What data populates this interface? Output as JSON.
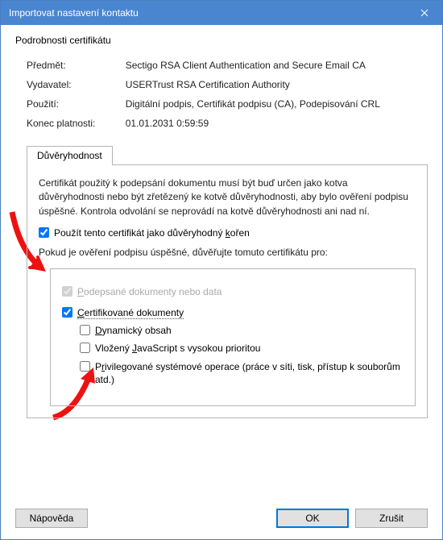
{
  "titlebar": {
    "title": "Importovat nastavení kontaktu"
  },
  "cert": {
    "section_title": "Podrobnosti certifikátu",
    "labels": {
      "subject": "Předmět:",
      "issuer": "Vydavatel:",
      "usage": "Použití:",
      "expires": "Konec platnosti:"
    },
    "values": {
      "subject": "Sectigo RSA Client Authentication and Secure Email CA",
      "issuer": "USERTrust RSA Certification Authority",
      "usage": "Digitální podpis, Certifikát podpisu (CA), Podepisování CRL",
      "expires": "01.01.2031 0:59:59"
    }
  },
  "tabs": {
    "trust": "Důvěryhodnost"
  },
  "trust": {
    "para1": "Certifikát použitý k podepsání dokumentu musí být buď určen jako kotva důvěryhodnosti nebo být zřetězený ke kotvě důvěryhodnosti, aby bylo ověření podpisu úspěšné.  Kontrola odvolání se neprovádí na kotvě důvěryhodnosti ani nad ní.",
    "use_root_pre": "Použít tento certifikát jako důvěryhodný ",
    "root_k_word_first": "k",
    "root_k_word_rest": "ořen",
    "para2": "Pokud je ověření podpisu úspěšné, důvěřujte tomuto certifikátu pro:",
    "opt_signed_pre": "",
    "opt_signed_first": "P",
    "opt_signed_rest": "odepsané dokumenty nebo data",
    "opt_certdoc_pre": "",
    "opt_certdoc_first": "C",
    "opt_certdoc_rest": "ertifikované dokumenty",
    "opt_dynamic_first": "D",
    "opt_dynamic_rest": "ynamický obsah",
    "opt_js_pre": "Vložený ",
    "opt_js_first": "J",
    "opt_js_rest": "avaScript s vysokou prioritou",
    "opt_priv_pre": "P",
    "opt_priv_first": "r",
    "opt_priv_rest": "ivilegované systémové operace (práce v síti, tisk, přístup k souborům atd.)"
  },
  "buttons": {
    "help": "Nápověda",
    "ok": "OK",
    "cancel": "Zrušit"
  }
}
